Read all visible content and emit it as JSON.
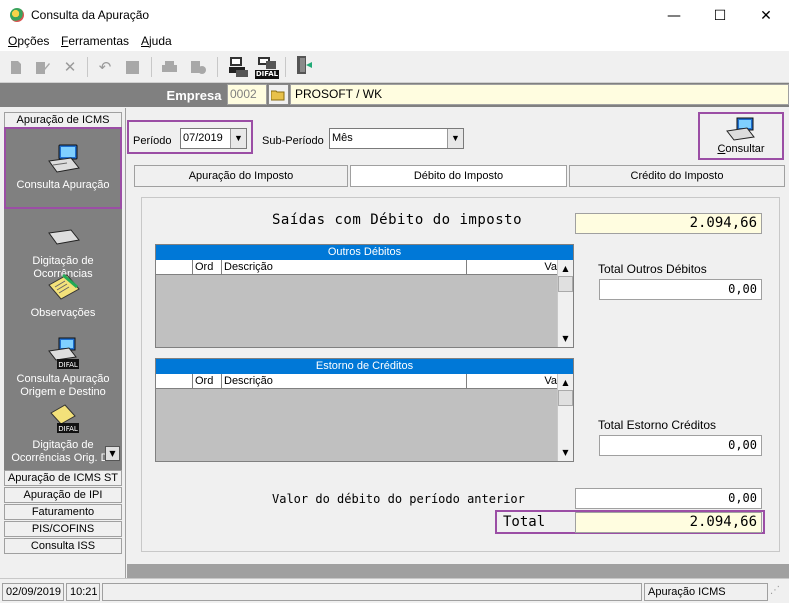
{
  "window": {
    "title": "Consulta da Apuração",
    "minimize": "—",
    "maximize": "☐",
    "close": "✕"
  },
  "menu": {
    "opcoes": {
      "first": "O",
      "rest": "pções"
    },
    "ferramentas": {
      "first": "F",
      "rest": "erramentas"
    },
    "ajuda": {
      "first": "A",
      "rest": "juda"
    }
  },
  "toolbar": {
    "icons": [
      "new-icon",
      "edit-icon",
      "delete-icon",
      "undo-icon",
      "stop-icon",
      "print-icon",
      "print-preview-icon",
      "report-icon",
      "difal-icon",
      "exit-icon"
    ],
    "difal_label": "DIFAL"
  },
  "empresa": {
    "label": "Empresa",
    "code": "0002",
    "name": "PROSOFT / WK"
  },
  "sidebar": {
    "header_top": "Apuração de ICMS",
    "items": [
      {
        "label": "Consulta Apuração",
        "icon": "computer-icon"
      },
      {
        "label": "Digitação de Ocorrências",
        "icon": "computer-icon"
      },
      {
        "label": "Observações",
        "icon": "notepad-icon"
      },
      {
        "label": "Consulta Apuração Origem e Destino",
        "icon": "difal-computer-icon",
        "badge": "DIFAL"
      },
      {
        "label": "Digitação de Ocorrências Orig. De",
        "icon": "difal-notepad-icon",
        "badge": "DIFAL"
      }
    ],
    "sections": [
      "Apuração de ICMS ST",
      "Apuração de IPI",
      "Faturamento",
      "PIS/COFINS",
      "Consulta ISS"
    ]
  },
  "filters": {
    "periodo_label": "Período",
    "periodo_value": "07/2019",
    "subperiodo_label": "Sub-Período",
    "subperiodo_value": "Mês",
    "consultar": {
      "first": "C",
      "rest": "onsultar"
    }
  },
  "tabs": [
    {
      "label": "Apuração do Imposto",
      "underline": "A"
    },
    {
      "label": "Débito do Imposto",
      "underline": "D"
    },
    {
      "label": "Crédito do Imposto",
      "underline": "C"
    }
  ],
  "debito": {
    "saidas_label": "Saídas com Débito do imposto",
    "saidas_value": "2.094,66",
    "outros_title": "Outros Débitos",
    "estorno_title": "Estorno de Créditos",
    "columns": {
      "ord": "Ord",
      "desc": "Descrição",
      "valor": "Va"
    },
    "total_outros_label": "Total Outros Débitos",
    "total_outros_value": "0,00",
    "total_estorno_label": "Total Estorno Créditos",
    "total_estorno_value": "0,00",
    "anterior_label": "Valor do débito do período anterior",
    "anterior_value": "0,00",
    "total_label": "Total",
    "total_value": "2.094,66"
  },
  "status": {
    "date": "02/09/2019",
    "time": "10:21",
    "module": "Apuração ICMS"
  },
  "colors": {
    "accent": "#9b4ea5",
    "grid_header": "#0078d7",
    "sidebar_bg": "#808080",
    "value_bg": "#fffde0"
  }
}
